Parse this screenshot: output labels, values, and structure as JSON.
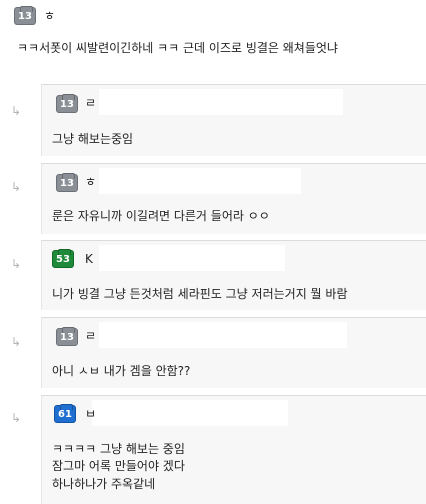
{
  "main_comment": {
    "badge": "13",
    "name": "ㅎ",
    "text": "ㅋㅋ서폿이 씨발련이긴하네 ㅋㅋ 근데 이즈로 빙결은 왜쳐들엇냐"
  },
  "replies": [
    {
      "badge": "13",
      "badge_color": "#8a8f96",
      "name": "ㄹ",
      "lines": [
        "그냥 해보는중임"
      ]
    },
    {
      "badge": "13",
      "badge_color": "#8a8f96",
      "name": "ㅎ",
      "lines": [
        "룬은 자유니까 이길려면 다른거 들어라 ㅇㅇ"
      ]
    },
    {
      "badge": "53",
      "badge_color": "#1f8a3a",
      "name": "K",
      "lines": [
        "니가 빙결 그냥 든것처럼 세라핀도 그냥 저러는거지 뭘 바람"
      ]
    },
    {
      "badge": "13",
      "badge_color": "#8a8f96",
      "name": "ㄹ",
      "lines": [
        "아니 ㅅㅂ 내가 겜을 안함??"
      ]
    },
    {
      "badge": "61",
      "badge_color": "#1f6fd1",
      "name": "ㅂ",
      "lines": [
        "ㅋㅋㅋㅋ 그냥 해보는 중임",
        "잠그마 어록 만들어야 겠다",
        "하나하나가 주옥같네"
      ]
    }
  ],
  "icons": {
    "reply_arrow": "reply-arrow-icon",
    "level_badge": "level-badge-icon"
  }
}
